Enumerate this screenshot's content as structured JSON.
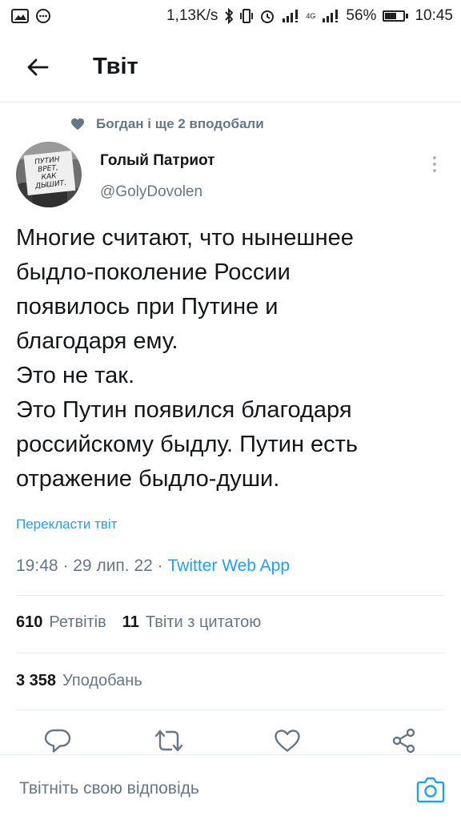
{
  "status_bar": {
    "net_speed": "1,13K/s",
    "network_type": "4G",
    "battery_percent": "56%",
    "battery_level": 0.56,
    "time": "10:45"
  },
  "header": {
    "title": "Твіт"
  },
  "social_context": {
    "liked_by": "Богдан і ще 2 вподобали"
  },
  "author": {
    "name": "Голый Патриот",
    "handle": "@GolyDovolen",
    "avatar_sign_text": [
      "ПУТИН",
      "ВРЕТ,",
      "КАК",
      "ДЫШИТ."
    ]
  },
  "tweet": {
    "lines": [
      "Многие считают, что нынешнее",
      "быдло-поколение России",
      "появилось при Путине и",
      "благодаря ему.",
      "Это не так.",
      "Это Путин появился благодаря",
      "российскому быдлу. Путин есть",
      "отражение быдло-души."
    ],
    "translate_label": "Перекласти твіт",
    "time": "19:48",
    "date": "29 лип. 22",
    "separator": "·",
    "source": "Twitter Web App"
  },
  "stats": {
    "retweets_count": "610",
    "retweets_label": "Ретвітів",
    "quotes_count": "11",
    "quotes_label": "Твіти з цитатою",
    "likes_count": "3 358",
    "likes_label": "Уподобань"
  },
  "reply": {
    "placeholder": "Твітніть свою відповідь"
  },
  "colors": {
    "accent": "#1da1f2",
    "secondary_text": "#657786",
    "primary_text": "#14171a",
    "divider": "#e6ecf0"
  },
  "icons": {
    "back": "arrow-left-icon",
    "liked": "heart-filled-icon",
    "more": "more-vertical-icon",
    "reply": "comment-icon",
    "retweet": "retweet-icon",
    "like": "heart-icon",
    "share": "share-icon",
    "camera": "camera-icon"
  }
}
